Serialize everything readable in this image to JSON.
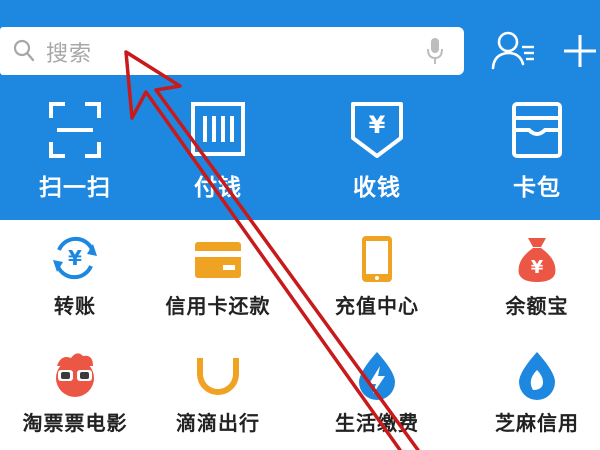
{
  "colors": {
    "header_bg": "#1e88e0",
    "orange": "#f0a223",
    "red": "#ec5644",
    "blue": "#1e88e0",
    "annotation": "#c8191b"
  },
  "search": {
    "placeholder": "搜索",
    "search_icon": "magnifier-icon",
    "voice_icon": "microphone-icon"
  },
  "top_actions": {
    "contacts_icon": "contacts-icon",
    "add_icon": "plus-icon"
  },
  "quick_actions": [
    {
      "label": "扫一扫",
      "icon": "scan-icon"
    },
    {
      "label": "付钱",
      "icon": "barcode-icon"
    },
    {
      "label": "收钱",
      "icon": "yuan-receive-icon"
    },
    {
      "label": "卡包",
      "icon": "card-wallet-icon"
    }
  ],
  "grid": [
    {
      "label": "转账",
      "icon": "transfer-icon"
    },
    {
      "label": "信用卡还款",
      "icon": "credit-card-icon"
    },
    {
      "label": "充值中心",
      "icon": "phone-topup-icon"
    },
    {
      "label": "余额宝",
      "icon": "money-bag-icon"
    },
    {
      "label": "淘票票电影",
      "icon": "movie-mascot-icon"
    },
    {
      "label": "滴滴出行",
      "icon": "didi-icon"
    },
    {
      "label": "生活缴费",
      "icon": "lightning-drop-icon"
    },
    {
      "label": "芝麻信用",
      "icon": "sesame-icon"
    }
  ]
}
